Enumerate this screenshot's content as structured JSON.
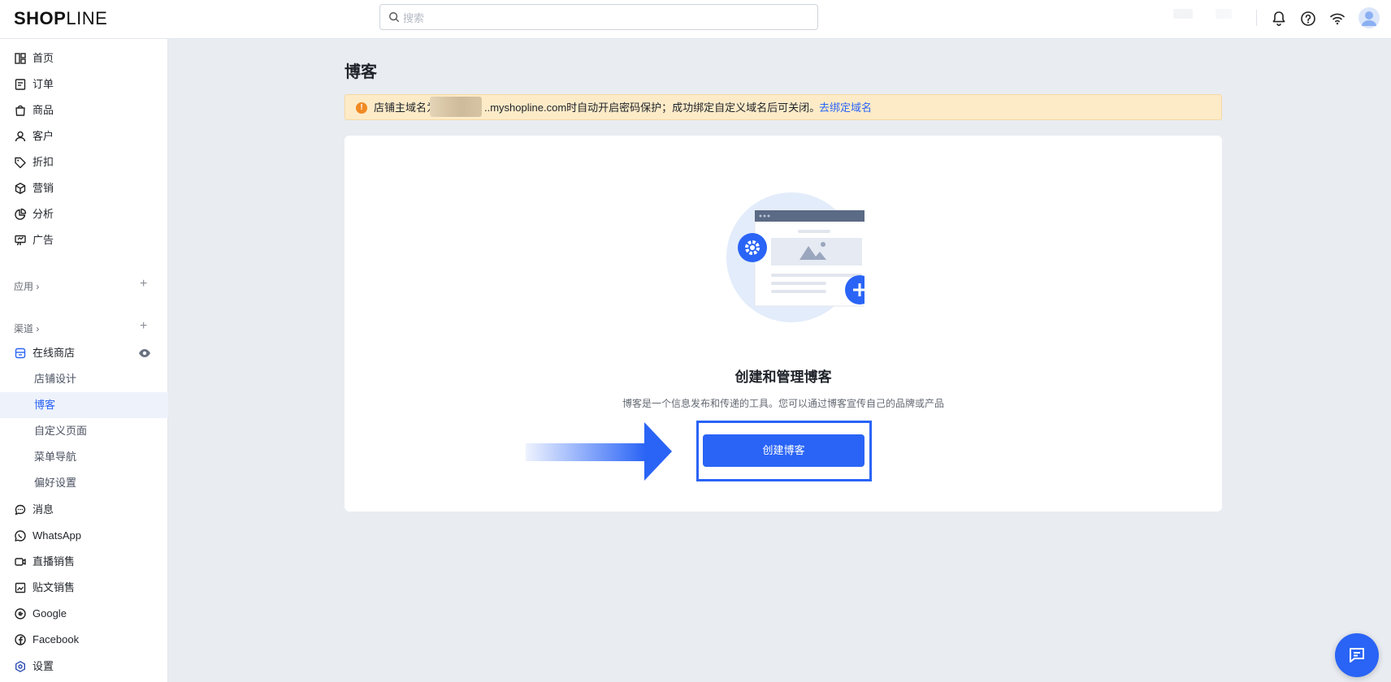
{
  "brand": {
    "logo_bold": "SHOP",
    "logo_light": "LINE"
  },
  "search": {
    "placeholder": "搜索"
  },
  "topbar_icons": [
    "bell-icon",
    "help-icon",
    "wifi-icon",
    "avatar-icon"
  ],
  "sidebar": {
    "main_items": [
      {
        "label": "首页",
        "icon": "home-icon"
      },
      {
        "label": "订单",
        "icon": "order-icon"
      },
      {
        "label": "商品",
        "icon": "bag-icon"
      },
      {
        "label": "客户",
        "icon": "person-icon"
      },
      {
        "label": "折扣",
        "icon": "tag-icon"
      },
      {
        "label": "营销",
        "icon": "cube-icon"
      },
      {
        "label": "分析",
        "icon": "pie-icon"
      },
      {
        "label": "广告",
        "icon": "board-icon"
      }
    ],
    "apps_label": "应用",
    "channels_label": "渠道",
    "online_store": {
      "label": "在线商店"
    },
    "sub_items": [
      {
        "label": "店铺设计",
        "active": false
      },
      {
        "label": "博客",
        "active": true
      },
      {
        "label": "自定义页面",
        "active": false
      },
      {
        "label": "菜单导航",
        "active": false
      },
      {
        "label": "偏好设置",
        "active": false
      }
    ],
    "bottom_items": [
      {
        "label": "消息",
        "icon": "message-icon"
      },
      {
        "label": "WhatsApp",
        "icon": "whatsapp-icon"
      },
      {
        "label": "直播销售",
        "icon": "video-icon"
      },
      {
        "label": "贴文销售",
        "icon": "post-icon"
      },
      {
        "label": "Google",
        "icon": "google-icon"
      },
      {
        "label": "Facebook",
        "icon": "facebook-icon"
      },
      {
        "label": "设置",
        "icon": "settings-icon"
      }
    ]
  },
  "main": {
    "title": "博客",
    "banner": {
      "text_before": "店铺主域名为",
      "text_after": "..myshopline.com时自动开启密码保护；成功绑定自定义域名后可关闭。",
      "link": "去绑定域名"
    },
    "empty_state": {
      "title": "创建和管理博客",
      "description": "博客是一个信息发布和传递的工具。您可以通过博客宣传自己的品牌或产品",
      "button_label": "创建博客"
    }
  },
  "colors": {
    "accent": "#2a64f6",
    "banner_bg": "#fdebc8",
    "page_bg": "#e9ecf1"
  }
}
